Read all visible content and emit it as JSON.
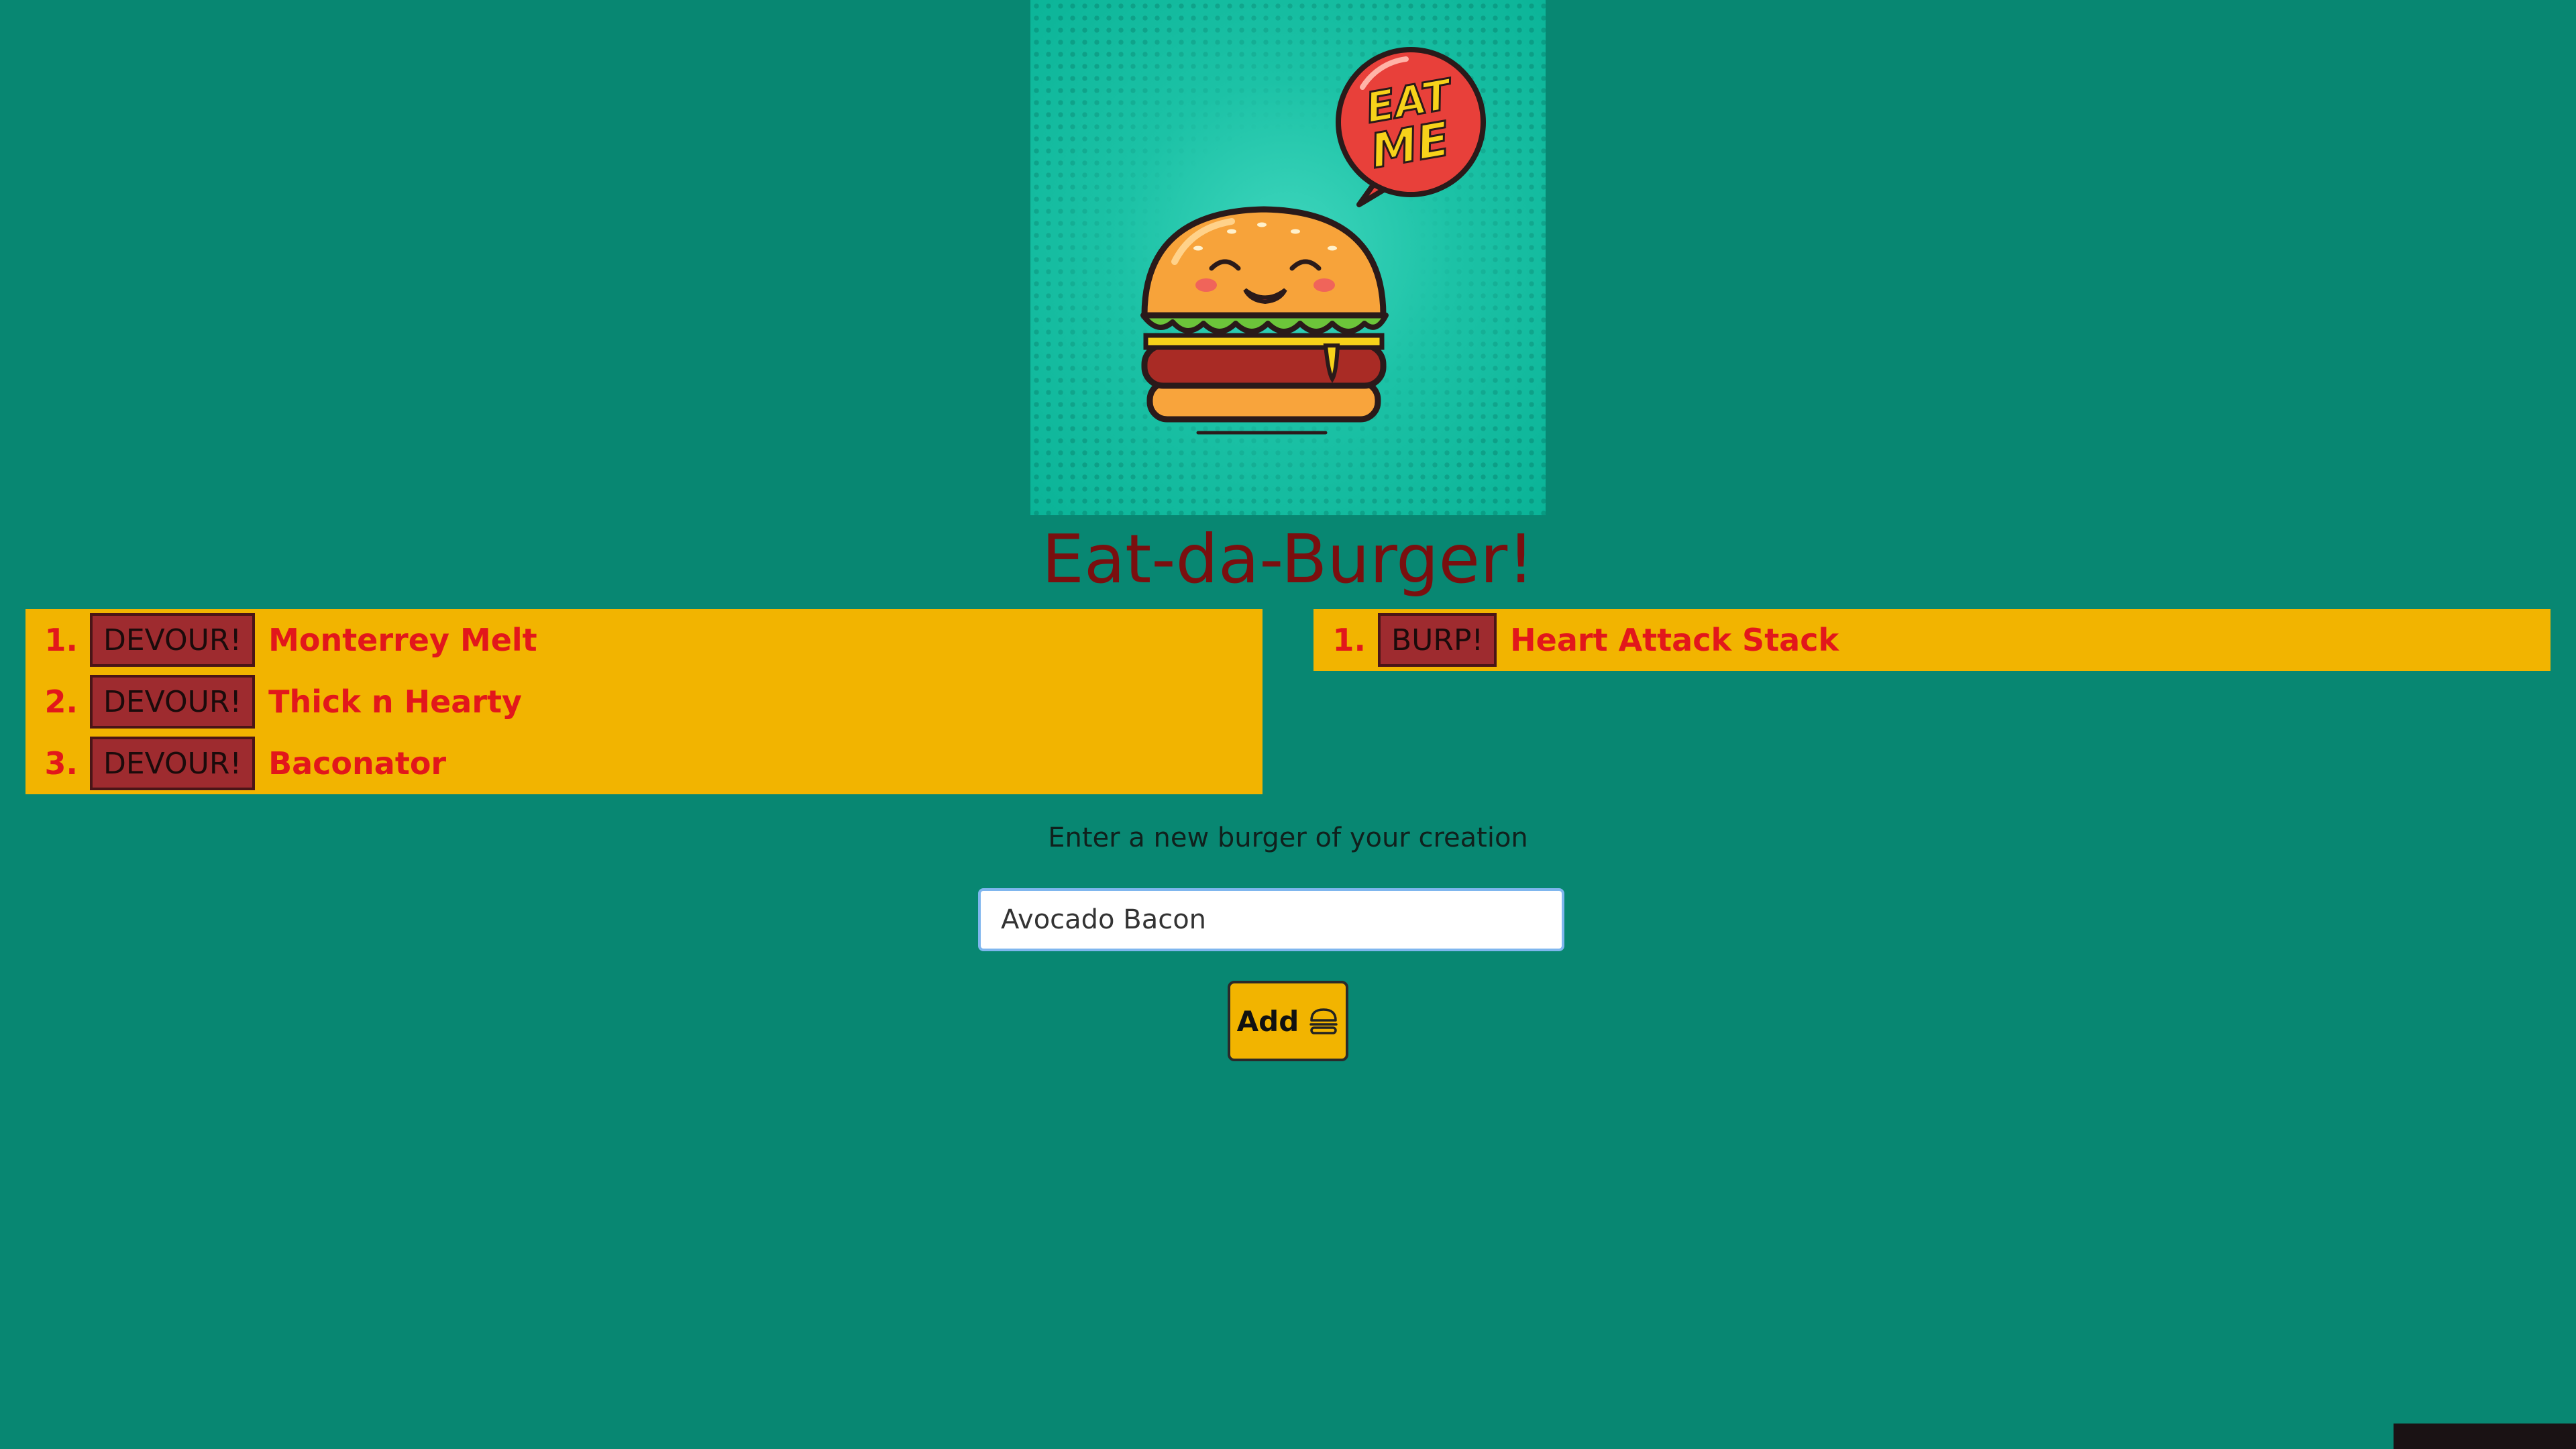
{
  "app": {
    "title": "Eat-da-Burger!"
  },
  "hero": {
    "speech_bubble": "EAT ME",
    "icon": "burger-mascot-icon"
  },
  "uneaten": [
    {
      "number": "1.",
      "button_label": "DEVOUR!",
      "name": "Monterrey Melt"
    },
    {
      "number": "2.",
      "button_label": "DEVOUR!",
      "name": "Thick n Hearty"
    },
    {
      "number": "3.",
      "button_label": "DEVOUR!",
      "name": "Baconator"
    }
  ],
  "devoured": [
    {
      "number": "1.",
      "button_label": "BURP!",
      "name": "Heart Attack Stack"
    }
  ],
  "form": {
    "prompt": "Enter a new burger of your creation",
    "input_value": "Avocado Bacon",
    "add_label": "Add",
    "add_icon": "hamburger-icon"
  },
  "colors": {
    "background": "#088772",
    "panel": "#f2b400",
    "button": "#9e2b2f",
    "item_text": "#e2171b",
    "title": "#7a0f0f"
  }
}
